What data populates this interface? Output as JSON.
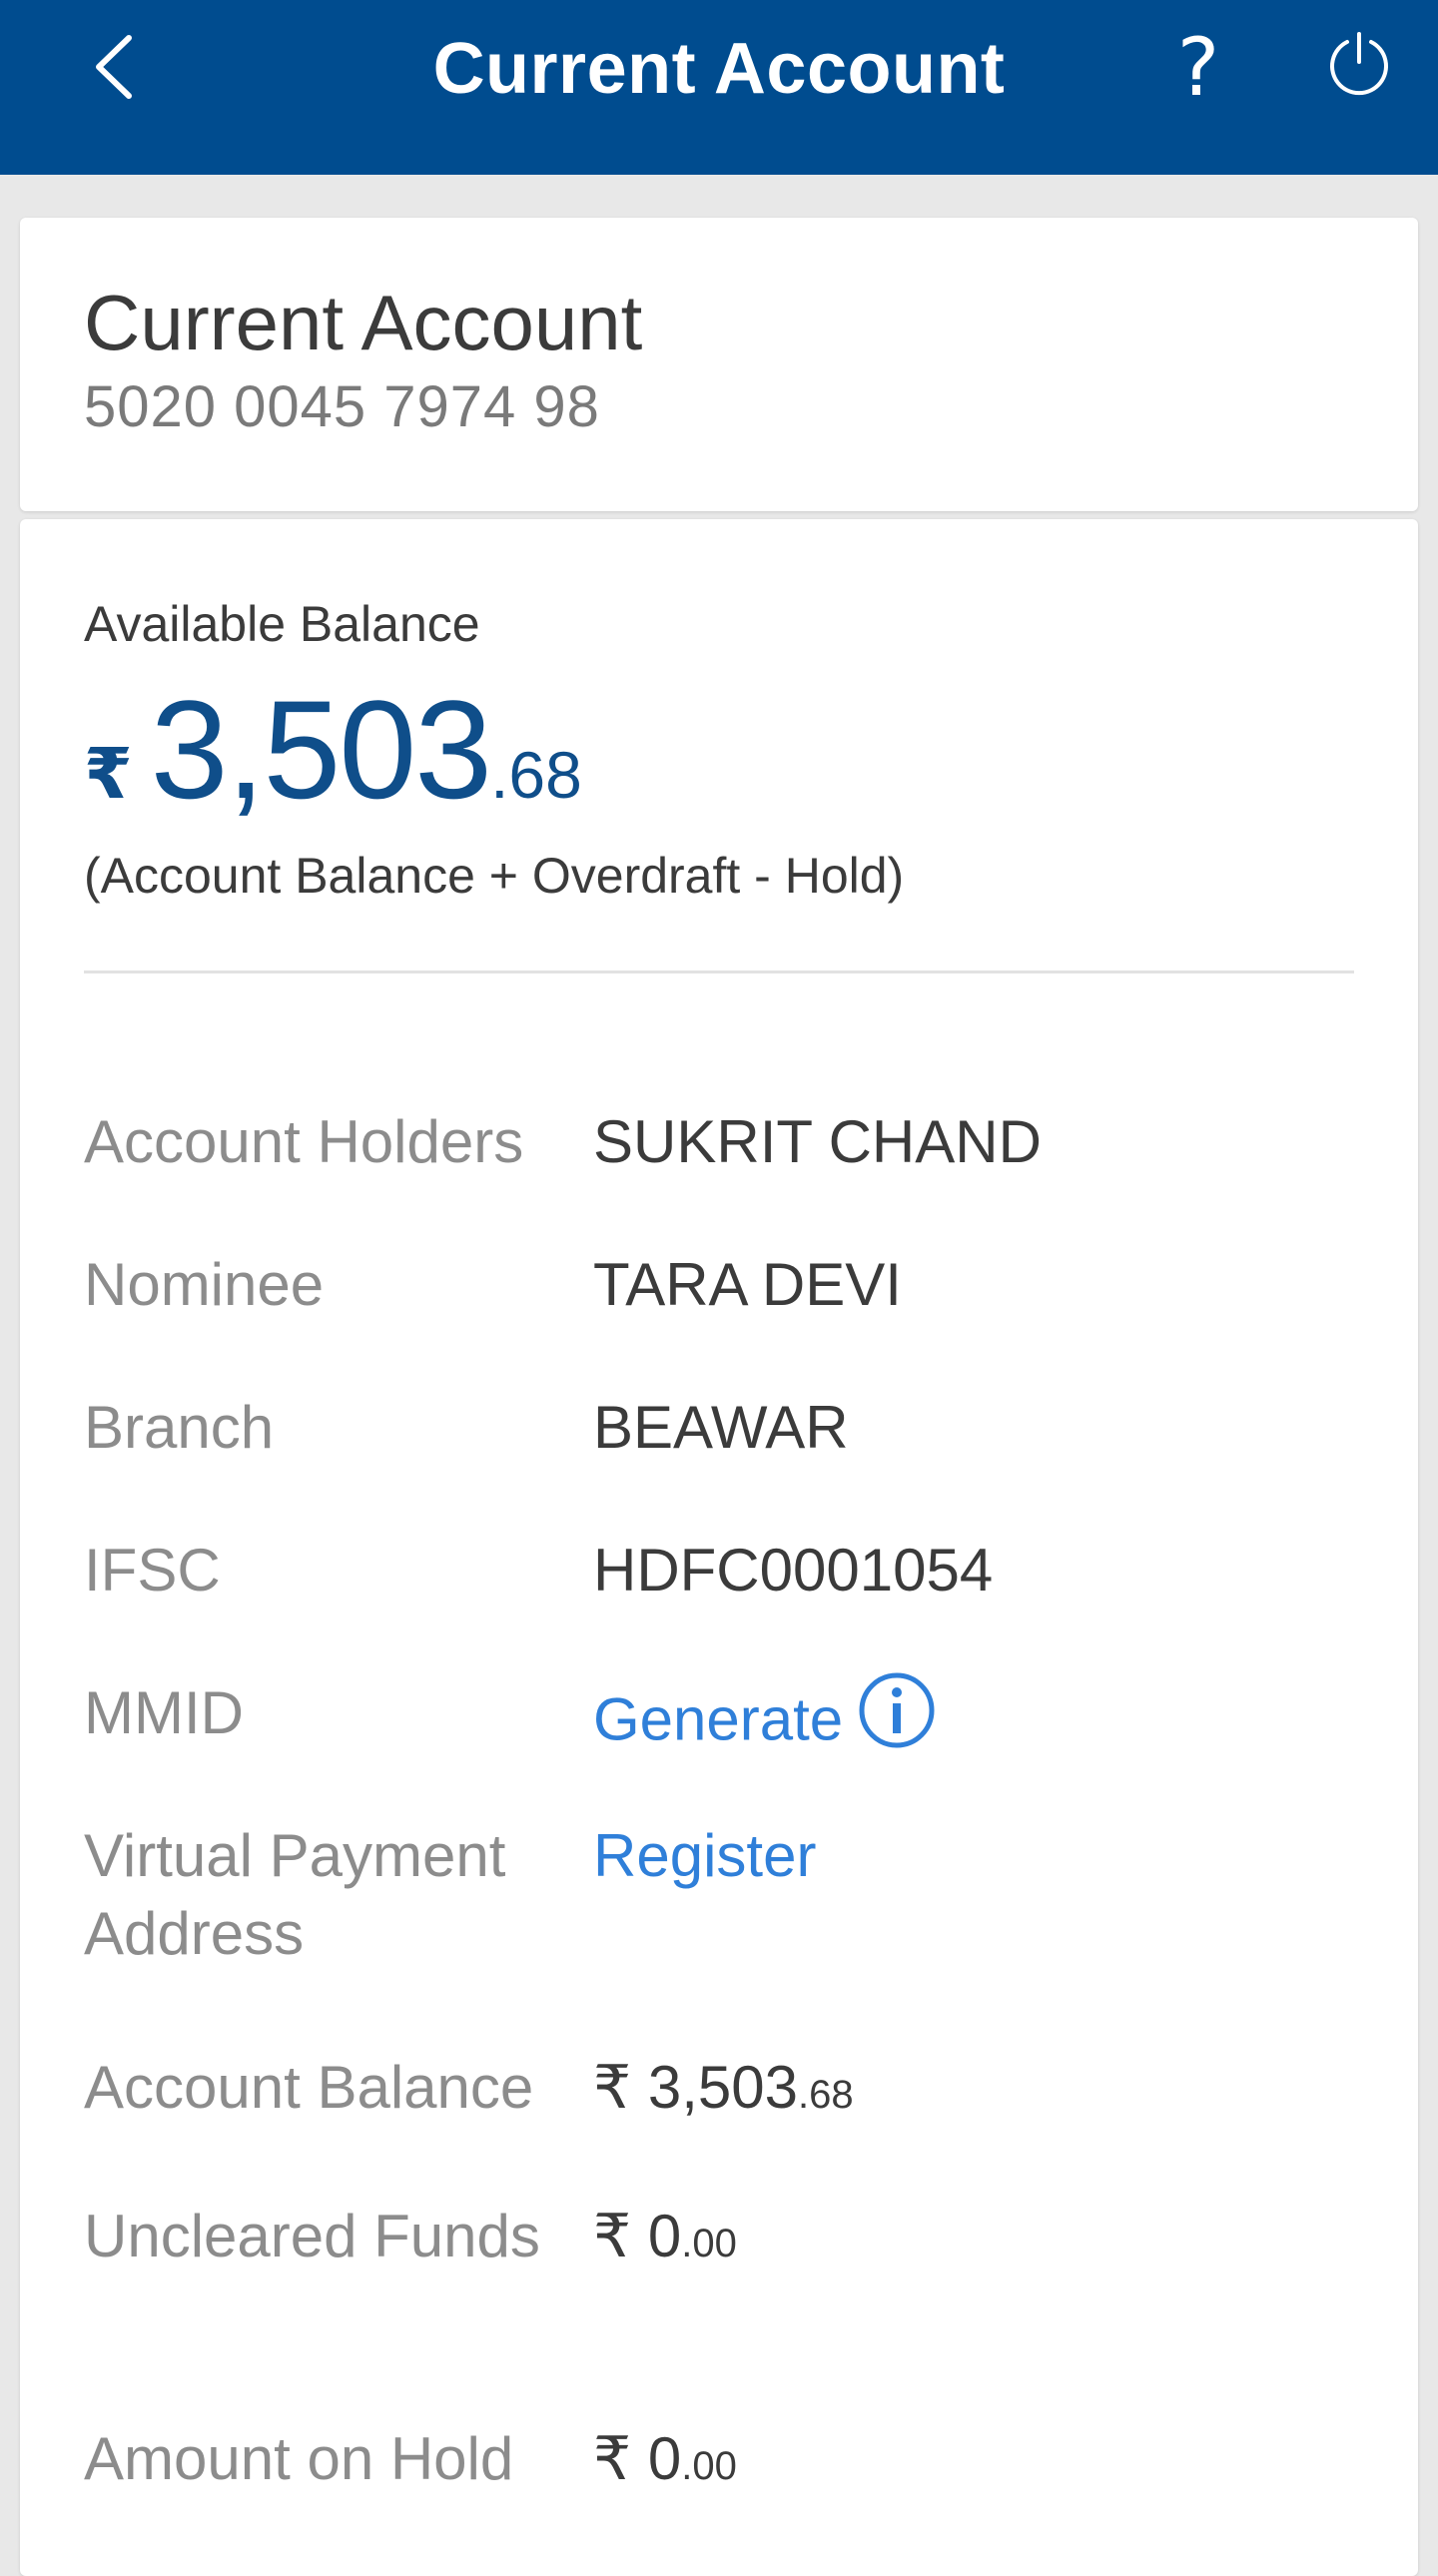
{
  "header": {
    "title": "Current Account",
    "help_glyph": "?",
    "icons": [
      "back-chevron-icon",
      "help-icon",
      "power-icon"
    ],
    "background": "#004c8f"
  },
  "account": {
    "name": "Current Account",
    "number": "5020 0045 7974 98"
  },
  "balance": {
    "label": "Available Balance",
    "currency_symbol": "₹",
    "amount_main": "3,503",
    "amount_decimal": ".68",
    "note": "(Account Balance + Overdraft - Hold)",
    "color": "#0f4e8a"
  },
  "details": {
    "account_holders": {
      "label": "Account Holders",
      "value": "SUKRIT CHAND"
    },
    "nominee": {
      "label": "Nominee",
      "value": "TARA DEVI"
    },
    "branch": {
      "label": "Branch",
      "value": "BEAWAR"
    },
    "ifsc": {
      "label": "IFSC",
      "value": "HDFC0001054"
    },
    "mmid": {
      "label": "MMID",
      "action": "Generate",
      "icon": "info-icon"
    },
    "vpa": {
      "label": "Virtual Payment Address",
      "action": "Register"
    },
    "account_balance": {
      "label": "Account Balance",
      "currency": "₹",
      "main": "3,503",
      "decimal": ".68"
    },
    "uncleared_funds": {
      "label": "Uncleared Funds",
      "currency": "₹",
      "main": "0",
      "decimal": ".00"
    },
    "amount_on_hold": {
      "label": "Amount on Hold",
      "currency": "₹",
      "main": "0",
      "decimal": ".00"
    },
    "link_color": "#2f7fd9"
  }
}
